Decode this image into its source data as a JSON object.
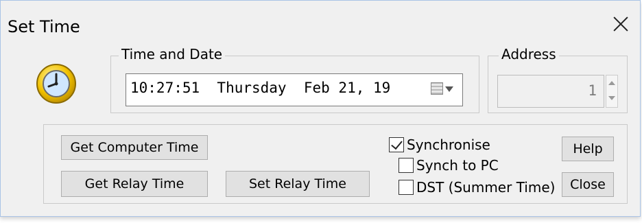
{
  "window": {
    "title": "Set Time"
  },
  "time_date": {
    "label": "Time and Date",
    "value": "10:27:51  Thursday  Feb 21, 19"
  },
  "address": {
    "label": "Address",
    "value": "1"
  },
  "buttons": {
    "get_computer_time": "Get Computer Time",
    "get_relay_time": "Get Relay Time",
    "set_relay_time": "Set Relay Time",
    "help": "Help",
    "close": "Close"
  },
  "checkboxes": {
    "synchronise": {
      "label": "Synchronise",
      "checked": true
    },
    "synch_to_pc": {
      "label": "Synch to PC",
      "checked": false
    },
    "dst": {
      "label": "DST (Summer Time)",
      "checked": false
    }
  }
}
